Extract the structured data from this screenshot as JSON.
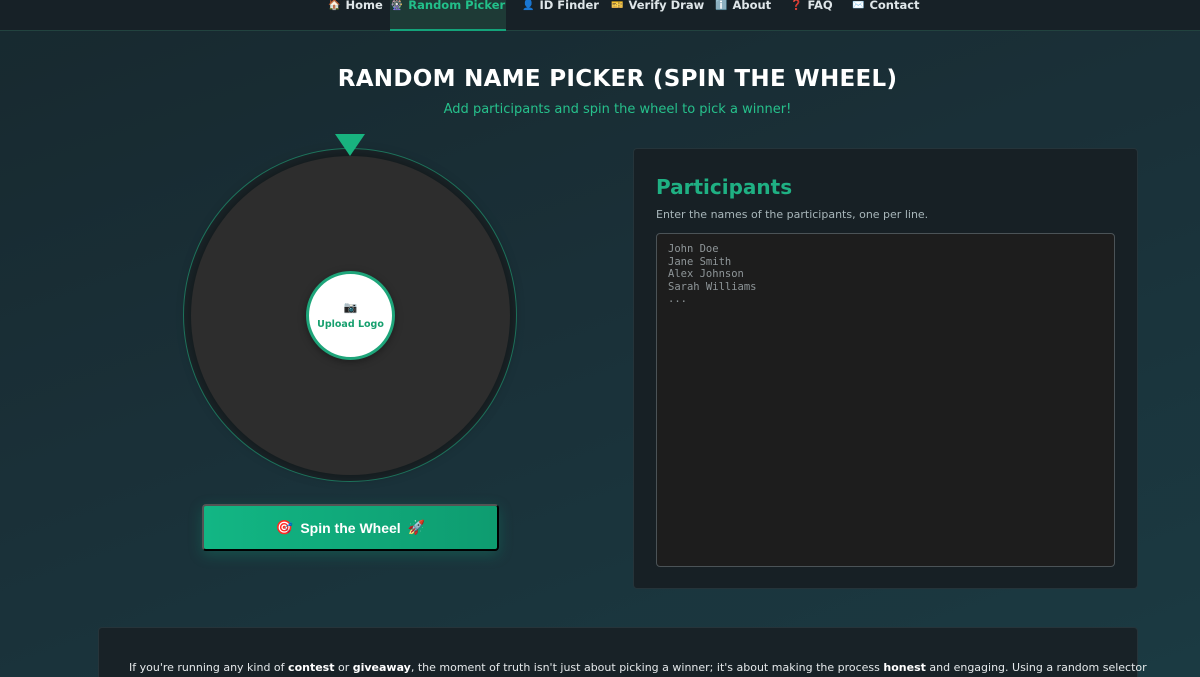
{
  "nav": {
    "items": [
      {
        "icon": "🏠",
        "label": "Home"
      },
      {
        "icon": "🎡",
        "label": "Random Picker"
      },
      {
        "icon": "👤",
        "label": "ID Finder"
      },
      {
        "icon": "🎫",
        "label": "Verify Draw"
      },
      {
        "icon": "ℹ️",
        "label": "About"
      },
      {
        "icon": "❓",
        "label": "FAQ"
      },
      {
        "icon": "✉️",
        "label": "Contact"
      }
    ],
    "active": "Random Picker"
  },
  "header": {
    "title": "RANDOM NAME PICKER (SPIN THE WHEEL)",
    "subtitle": "Add participants and spin the wheel to pick a winner!"
  },
  "wheel": {
    "logo_icon": "📷",
    "logo_label": "Upload Logo",
    "spin_icon_left": "🎯",
    "spin_label": "Spin the Wheel",
    "spin_icon_right": "🚀"
  },
  "participants": {
    "title": "Participants",
    "description": "Enter the names of the participants, one per line.",
    "placeholder": "John Doe\nJane Smith\nAlex Johnson\nSarah Williams\n...",
    "value": ""
  },
  "article": {
    "t1": "If you're running any kind of ",
    "b1": "contest",
    "t2": " or ",
    "b2": "giveaway",
    "t3": ", the moment of truth isn't just about picking a winner; it's about making the process ",
    "b3": "honest",
    "t4": " and engaging. Using a random selector"
  },
  "colors": {
    "accent": "#1fb083",
    "nav_bg": "#172127",
    "wheel": "#2d2d2d",
    "panel_bg": "#172025"
  }
}
